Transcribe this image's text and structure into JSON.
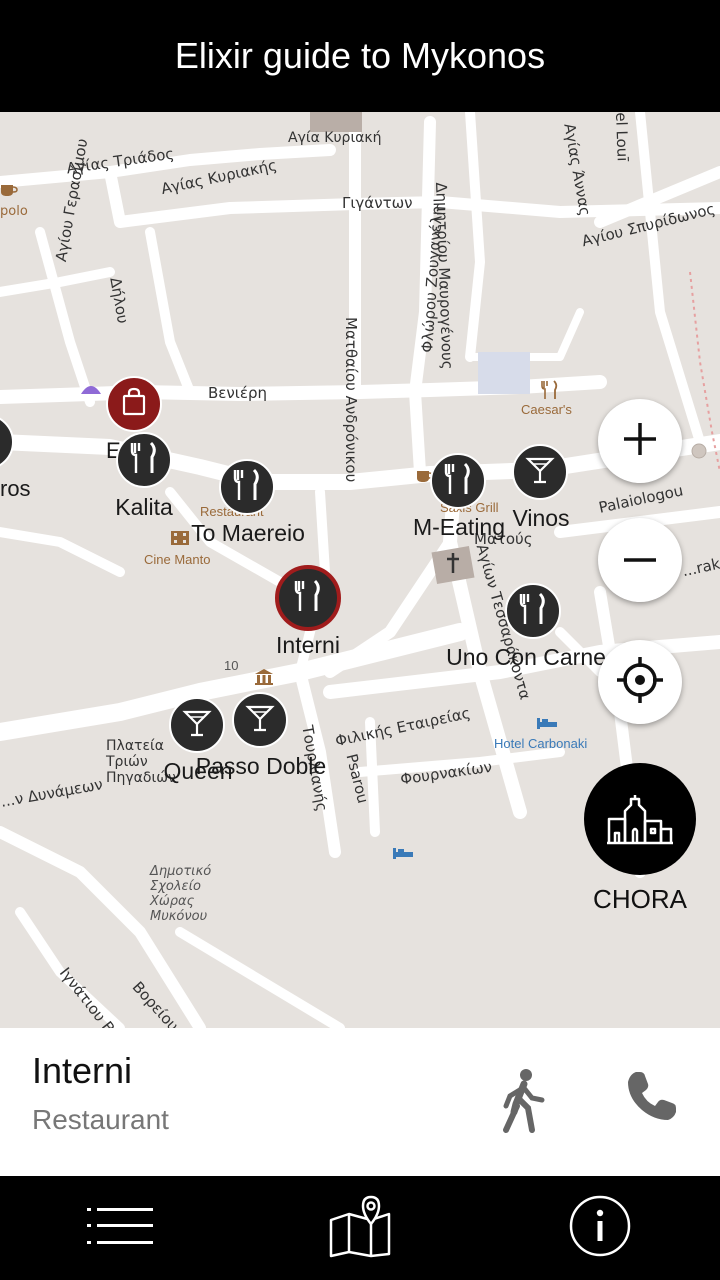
{
  "header": {
    "title": "Elixir guide to Mykonos"
  },
  "map": {
    "streets": {
      "agia_kyriaki_church": "Αγία Κυριακή",
      "agias_triados": "Αγίας Τριάδος",
      "agias_kyriakis": "Αγίας Κυριακής",
      "gigantwn": "Γιγάντων",
      "dimitriou_mavrogenous": "Δημητρίου Μαυρογένους",
      "agias_annas": "Αγίας Άννας",
      "el_loui": "el Louī",
      "agiou_spyridonos": "Αγίου Σπυρίδωνος",
      "agiou_gerasimou": "Αγίου Γερασίμου",
      "dilou": "Δήλου",
      "flwrou_zouganeli": "Φλώρου Ζουγανέλη",
      "mathaiou_andronikou": "Ματθαίου Ανδρόνικου",
      "venieri": "Βενιέρη",
      "palaiologou": "Palaiologou",
      "aglwn_tessarakonta": "Αγίων Τεσσαράκοντα",
      "matoys": "Ματούς",
      "trakii": "...raki",
      "filikis_etaireias": "Φιλικής Εταιρείας",
      "psarou": "Psarou",
      "tourlianis": "Τουρλιανής",
      "fournakiwn": "Φουρνακίων",
      "plateia_triwn_pigadiwn": "Πλατεία Τριών Πηγαδιών",
      "dynamewn": "...ν Δυνάμεων",
      "dimotiko_sxoleio": "Δημοτικό Σχολείο Χώρας Μυκόνου",
      "ignatiou_basileiou": "Ιγνάτιου Β...",
      "boreiou": "Βορείου...",
      "polo": "polo",
      "ros": "ros",
      "kontopoli": "Ε"
    },
    "pois": {
      "caesars": "Caesar's",
      "saxis_grill": "Saxis Grill",
      "restaurant": "Restaurant",
      "cine_manto": "Cine Manto",
      "hotel_carbonaki": "Hotel Carbonaki",
      "number_10": "10"
    },
    "markers": [
      {
        "label": "Kalita",
        "icon": "cutlery-icon"
      },
      {
        "label": "To Maereio",
        "icon": "cutlery-icon"
      },
      {
        "label": "M-Eating",
        "icon": "cutlery-icon"
      },
      {
        "label": "Vinos",
        "icon": "cocktail-icon"
      },
      {
        "label": "Interni",
        "icon": "cutlery-icon"
      },
      {
        "label": "Uno Con Carne",
        "icon": "cutlery-icon"
      },
      {
        "label": "Queen",
        "icon": "cocktail-icon"
      },
      {
        "label": "Passo Doble",
        "icon": "cocktail-icon"
      },
      {
        "label": "",
        "icon": "shopping-bag-icon"
      }
    ],
    "chora_label": "CHORA"
  },
  "info": {
    "name": "Interni",
    "type": "Restaurant"
  },
  "nav": {
    "list": "list-icon",
    "map": "map-icon",
    "info": "info-icon"
  },
  "colors": {
    "header_bg": "#000000",
    "selected_ring": "#a01c1c",
    "marker_bg": "#2b2b2b"
  }
}
